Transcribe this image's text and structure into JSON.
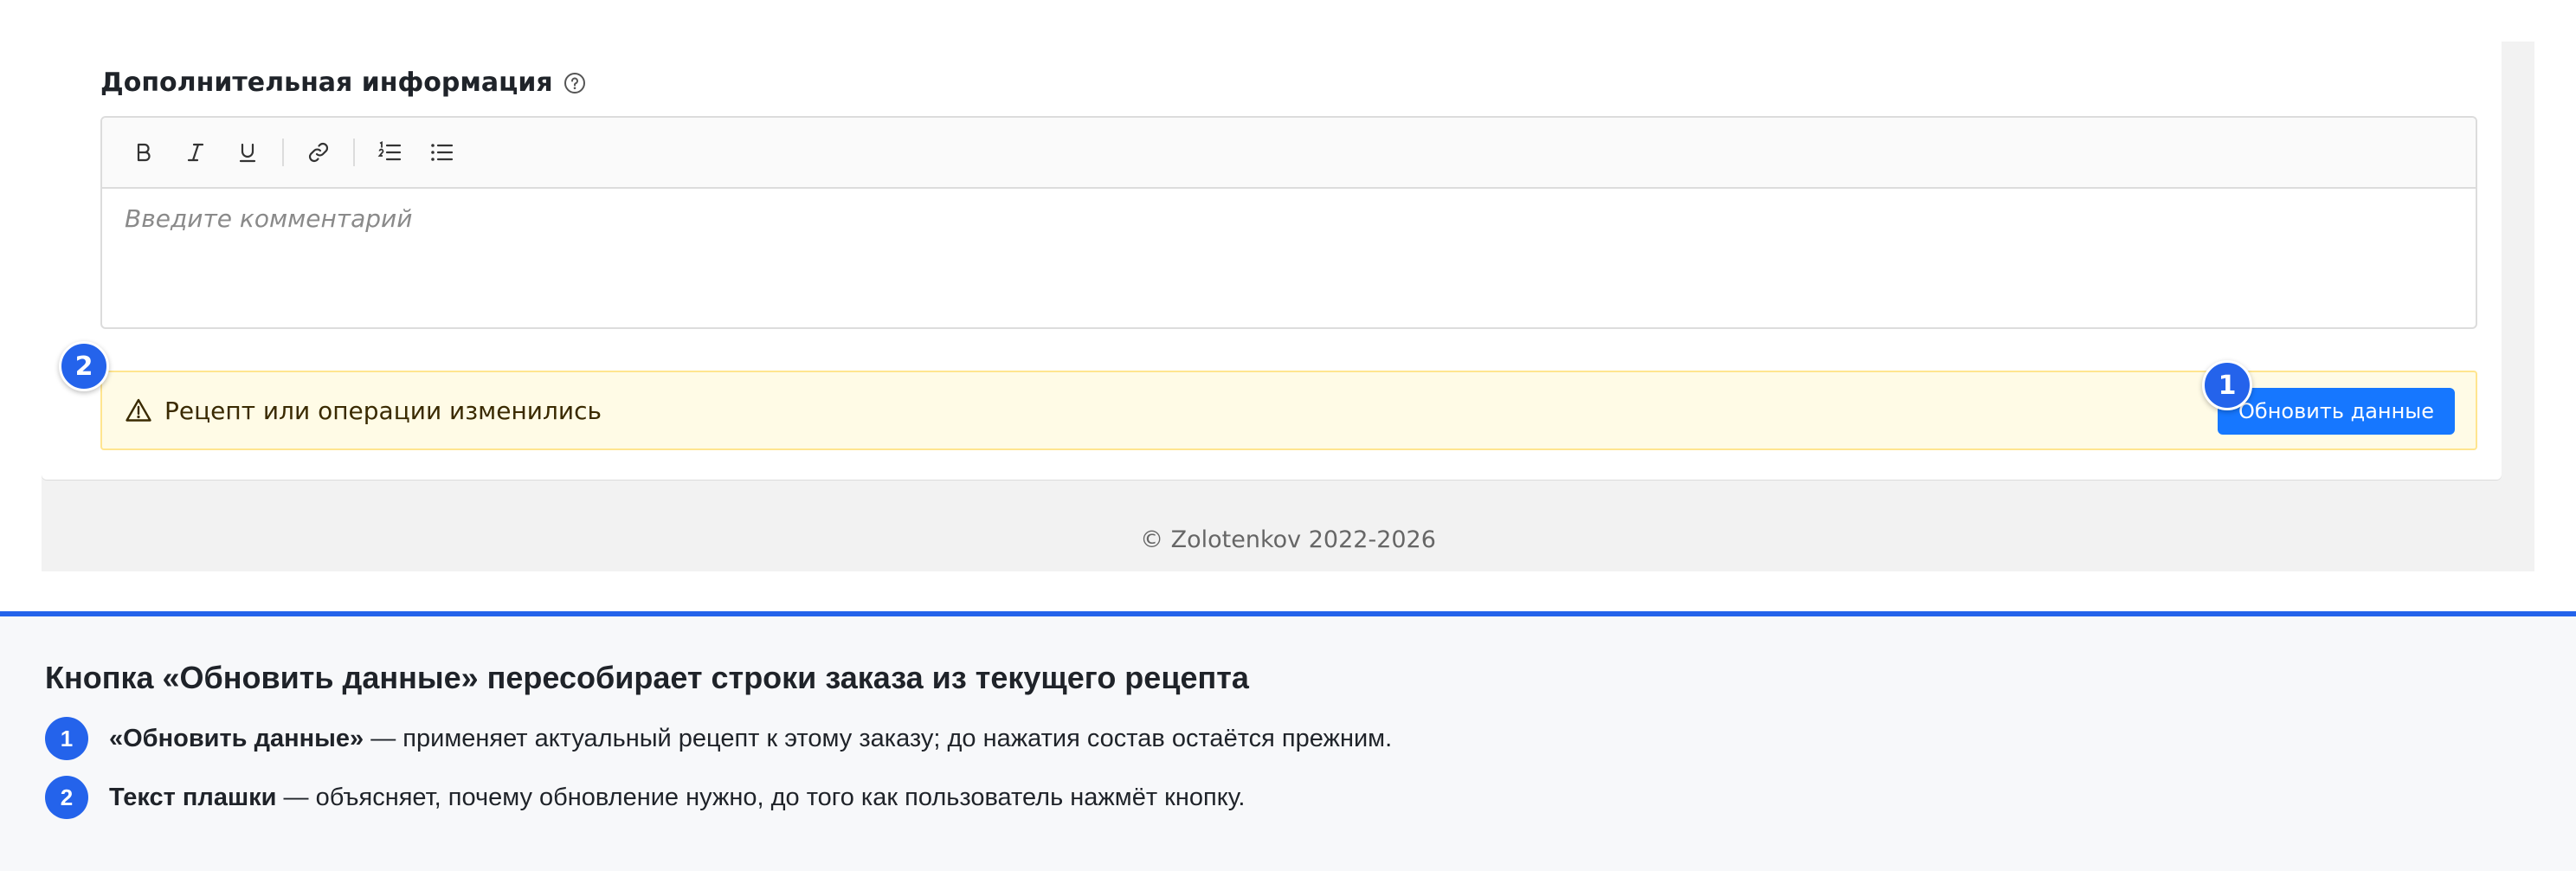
{
  "editor_section": {
    "title": "Дополнительная информация",
    "placeholder": "Введите комментарий",
    "toolbar": [
      "bold-icon",
      "italic-icon",
      "underline-icon",
      "link-icon",
      "ordered-list-icon",
      "bullet-list-icon"
    ]
  },
  "alert": {
    "text": "Рецепт или операции изменились",
    "button_label": "Обновить данные",
    "colors": {
      "background": "#fffbe6",
      "border": "#ffe58f",
      "button": "#1677ff"
    }
  },
  "markers": {
    "button": "1",
    "alert": "2"
  },
  "footer": {
    "copyright": "© Zolotenkov 2022-2026"
  },
  "explanation": {
    "title": "Кнопка «Обновить данные» пересобирает строки заказа из текущего рецепта",
    "items": [
      {
        "num": "1",
        "term": "«Обновить данные»",
        "desc": " — применяет актуальный рецепт к этому заказу; до нажатия состав остаётся прежним."
      },
      {
        "num": "2",
        "term": "Текст плашки",
        "desc": " — объясняет, почему обновление нужно, до того как пользователь нажмёт кнопку."
      }
    ],
    "accent": "#2463eb"
  }
}
